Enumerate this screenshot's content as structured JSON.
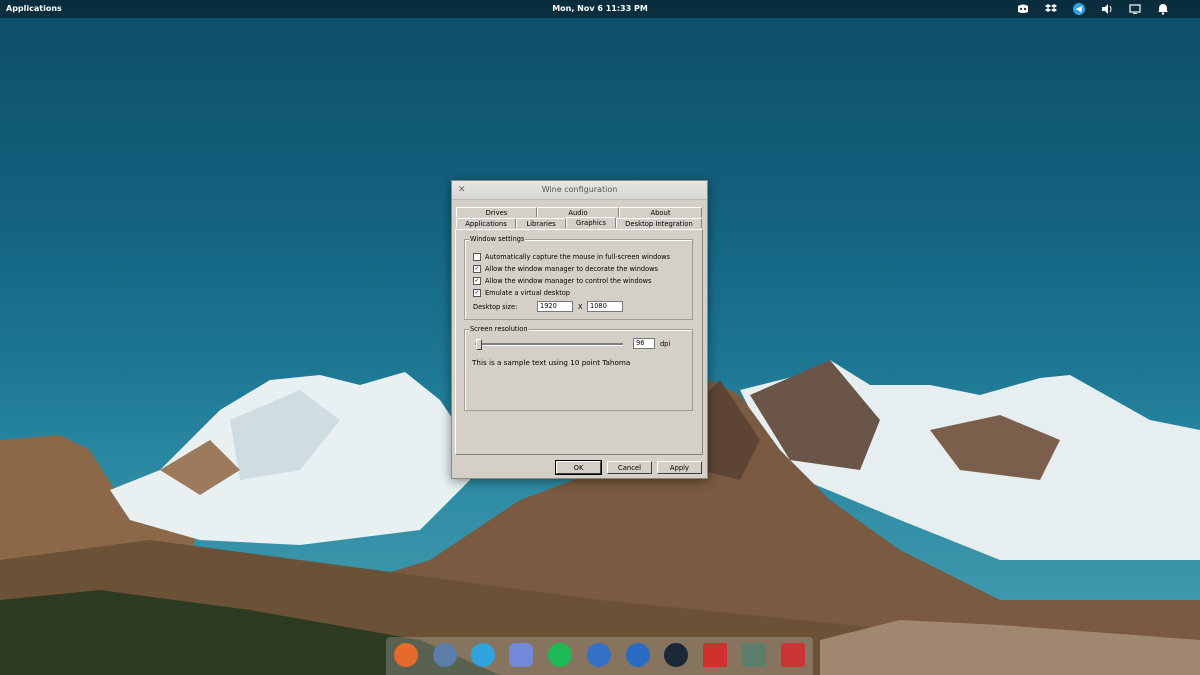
{
  "top_panel": {
    "applications_label": "Applications",
    "clock": "Mon, Nov  6    11:33 PM",
    "tray_icons": [
      "discord-icon",
      "dropbox-icon",
      "telegram-icon",
      "volume-icon",
      "display-icon",
      "notifications-icon"
    ]
  },
  "dialog": {
    "title": "Wine configuration",
    "tabs_row1": [
      "Drives",
      "Audio",
      "About"
    ],
    "tabs_row2": [
      "Applications",
      "Libraries",
      "Graphics",
      "Desktop Integration"
    ],
    "active_tab": "Graphics",
    "window_settings": {
      "title": "Window settings",
      "options": [
        {
          "label": "Automatically capture the mouse in full-screen windows",
          "checked": false
        },
        {
          "label": "Allow the window manager to decorate the windows",
          "checked": true
        },
        {
          "label": "Allow the window manager to control the windows",
          "checked": true
        },
        {
          "label": "Emulate a virtual desktop",
          "checked": true
        }
      ],
      "desktop_size_label": "Desktop size:",
      "width": "1920",
      "x_label": "X",
      "height": "1080"
    },
    "screen_resolution": {
      "title": "Screen resolution",
      "dpi_value": "96",
      "dpi_unit": "dpi",
      "slider_fraction": 0.0,
      "sample_text": "This is a sample text using 10 point Tahoma"
    },
    "buttons": {
      "ok": "OK",
      "cancel": "Cancel",
      "apply": "Apply"
    }
  },
  "dock": {
    "apps": [
      "firefox",
      "geary",
      "telegram",
      "discord",
      "spotify",
      "simplenote",
      "qbittorrent",
      "steam",
      "wps-writer",
      "files",
      "scroll-tool"
    ],
    "colors": {
      "firefox": "#e66a2c",
      "geary": "#5b7fa8",
      "telegram": "#2ea3dd",
      "discord": "#7289da",
      "spotify": "#1db954",
      "simplenote": "#3470c4",
      "qbittorrent": "#2c6bc4",
      "steam": "#1b2838",
      "wps-writer": "#d0312d",
      "files": "#5c7d6b",
      "scroll-tool": "#cc3333"
    }
  }
}
